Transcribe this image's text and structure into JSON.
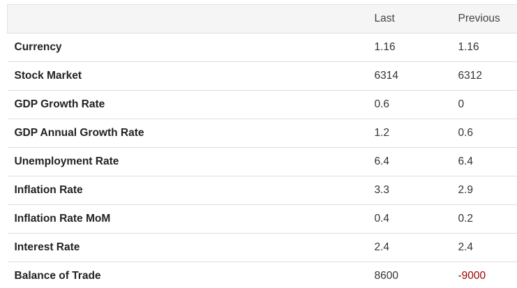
{
  "table": {
    "headers": {
      "name": "",
      "last": "Last",
      "previous": "Previous"
    },
    "rows": [
      {
        "name": "Currency",
        "last": "1.16",
        "previous": "1.16"
      },
      {
        "name": "Stock Market",
        "last": "6314",
        "previous": "6312"
      },
      {
        "name": "GDP Growth Rate",
        "last": "0.6",
        "previous": "0"
      },
      {
        "name": "GDP Annual Growth Rate",
        "last": "1.2",
        "previous": "0.6"
      },
      {
        "name": "Unemployment Rate",
        "last": "6.4",
        "previous": "6.4"
      },
      {
        "name": "Inflation Rate",
        "last": "3.3",
        "previous": "2.9"
      },
      {
        "name": "Inflation Rate MoM",
        "last": "0.4",
        "previous": "0.2"
      },
      {
        "name": "Interest Rate",
        "last": "2.4",
        "previous": "2.4"
      },
      {
        "name": "Balance of Trade",
        "last": "8600",
        "previous": "-9000"
      }
    ]
  },
  "colors": {
    "negative_value": "#990000",
    "header_background": "#f5f5f5",
    "row_divider": "#dddddd"
  }
}
